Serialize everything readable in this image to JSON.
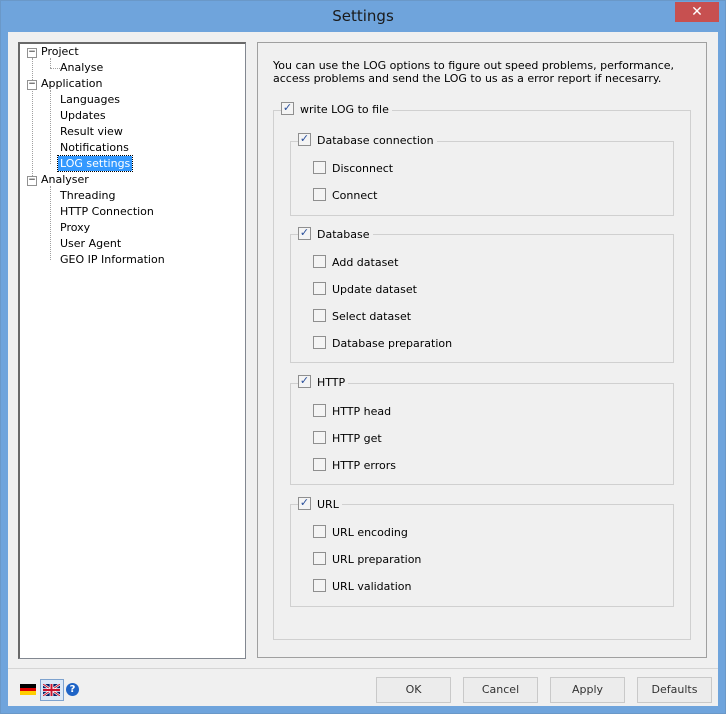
{
  "window": {
    "title": "Settings",
    "close_glyph": "✕"
  },
  "tree": {
    "project": {
      "label": "Project",
      "children": [
        "Analyse"
      ]
    },
    "application": {
      "label": "Application",
      "children": [
        "Languages",
        "Updates",
        "Result view",
        "Notifications",
        "LOG settings"
      ]
    },
    "analyser": {
      "label": "Analyser",
      "children": [
        "Threading",
        "HTTP Connection",
        "Proxy",
        "User Agent",
        "GEO IP Information"
      ]
    },
    "selected": "LOG settings"
  },
  "log": {
    "description": "You can use the LOG options to figure out speed problems, performance, access problems and send the LOG to us as a error report if necesarry.",
    "write_to_file": {
      "label": "write LOG to file",
      "checked": true
    },
    "groups": [
      {
        "label": "Database connection",
        "checked": true,
        "options": [
          {
            "label": "Disconnect",
            "checked": false
          },
          {
            "label": "Connect",
            "checked": false
          }
        ]
      },
      {
        "label": "Database",
        "checked": true,
        "options": [
          {
            "label": "Add dataset",
            "checked": false
          },
          {
            "label": "Update dataset",
            "checked": false
          },
          {
            "label": "Select dataset",
            "checked": false
          },
          {
            "label": "Database preparation",
            "checked": false
          }
        ]
      },
      {
        "label": "HTTP",
        "checked": true,
        "options": [
          {
            "label": "HTTP head",
            "checked": false
          },
          {
            "label": "HTTP get",
            "checked": false
          },
          {
            "label": "HTTP errors",
            "checked": false
          }
        ]
      },
      {
        "label": "URL",
        "checked": true,
        "options": [
          {
            "label": "URL encoding",
            "checked": false
          },
          {
            "label": "URL preparation",
            "checked": false
          },
          {
            "label": "URL validation",
            "checked": false
          }
        ]
      }
    ]
  },
  "footer": {
    "ok_label": "OK",
    "cancel_label": "Cancel",
    "apply_label": "Apply",
    "defaults_label": "Defaults",
    "help_glyph": "?"
  },
  "colors": {
    "accent": "#3399ff",
    "frame": "#6fa4dc",
    "close": "#c75050",
    "check": "#2a4f9a"
  }
}
